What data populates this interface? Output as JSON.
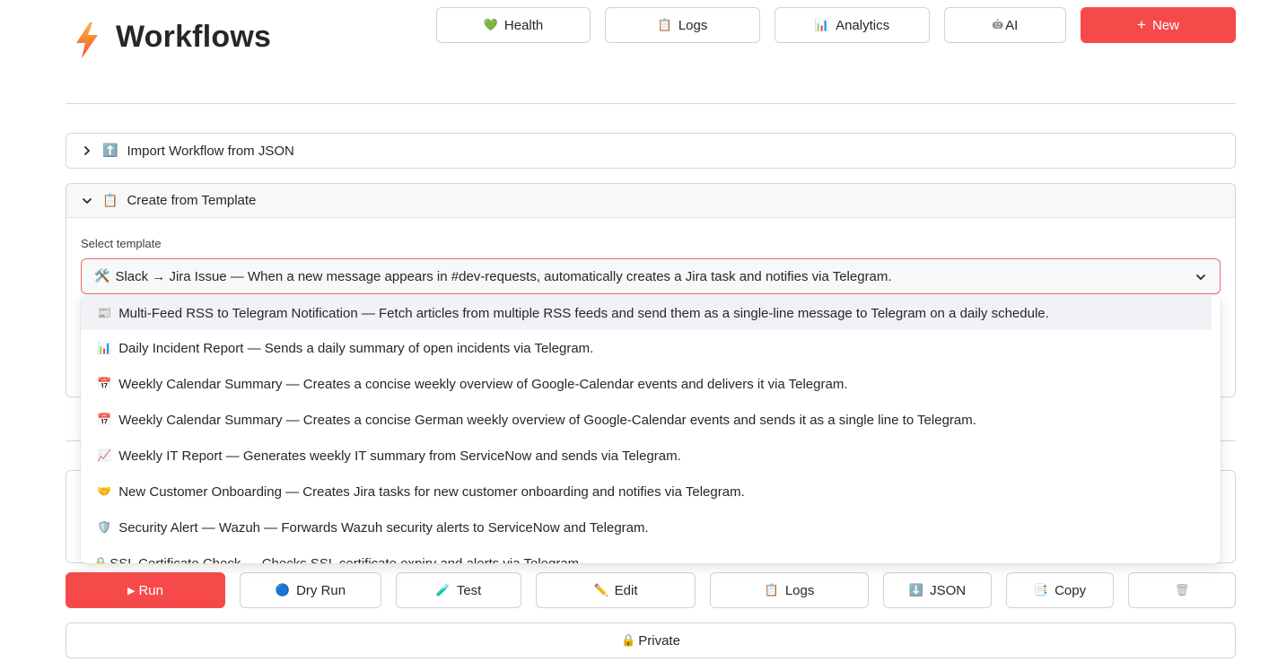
{
  "header": {
    "title": "Workflows",
    "logo_icon": "lightning-bolt-icon",
    "buttons": [
      {
        "label": "Health",
        "icon": "green-heart-icon",
        "glyph": "💚"
      },
      {
        "label": "Logs",
        "icon": "clipboard-icon",
        "glyph": "📋"
      },
      {
        "label": "Analytics",
        "icon": "bar-chart-icon",
        "glyph": "📊"
      },
      {
        "label": "AI",
        "icon": "robot-icon",
        "glyph": "🤖"
      },
      {
        "label": "New",
        "icon": "plus-icon",
        "glyph": "+"
      }
    ]
  },
  "import_section": {
    "label": "Import Workflow from JSON",
    "glyph": "⬆️",
    "expanded": false
  },
  "template_section": {
    "label": "Create from Template",
    "glyph": "📋",
    "expanded": true,
    "field_label": "Select template",
    "selected": {
      "glyph": "🛠️",
      "text": "Slack → Jira Issue — When a new message appears in #dev-requests, automatically creates a Jira task and notifies via Telegram."
    },
    "options": [
      {
        "glyph": "📰",
        "text": "Multi-Feed RSS to Telegram Notification — Fetch articles from multiple RSS feeds and send them as a single-line message to Telegram on a daily schedule."
      },
      {
        "glyph": "📊",
        "text": "Daily Incident Report — Sends a daily summary of open incidents via Telegram."
      },
      {
        "glyph": "📅",
        "text": "Weekly Calendar Summary — Creates a concise weekly overview of Google-Calendar events and delivers it via Telegram."
      },
      {
        "glyph": "📅",
        "text": "Weekly Calendar Summary — Creates a concise German weekly overview of Google-Calendar events and sends it as a single line to Telegram."
      },
      {
        "glyph": "📈",
        "text": "Weekly IT Report — Generates weekly IT summary from ServiceNow and sends via Telegram."
      },
      {
        "glyph": "🤝",
        "text": "New Customer Onboarding — Creates Jira tasks for new customer onboarding and notifies via Telegram."
      },
      {
        "glyph": "🛡️",
        "text": "Security Alert — Wazuh — Forwards Wazuh security alerts to ServiceNow and Telegram."
      },
      {
        "glyph": "🔒",
        "text": "SSL Certificate Check — Checks SSL certificate expiry and alerts via Telegram."
      }
    ]
  },
  "actions": [
    {
      "label": "Run",
      "glyph": "▶"
    },
    {
      "label": "Dry Run",
      "glyph": "🔵"
    },
    {
      "label": "Test",
      "glyph": "🧪"
    },
    {
      "label": "Edit",
      "glyph": "✏️"
    },
    {
      "label": "Logs",
      "glyph": "📋"
    },
    {
      "label": "JSON",
      "glyph": "⬇️"
    },
    {
      "label": "Copy",
      "glyph": "📑"
    },
    {
      "label": "",
      "glyph": "🗑"
    }
  ],
  "visibility": {
    "label": "Private",
    "glyph": "🔒"
  },
  "colors": {
    "accent": "#f64a4a",
    "select_border": "#f06a6a"
  }
}
